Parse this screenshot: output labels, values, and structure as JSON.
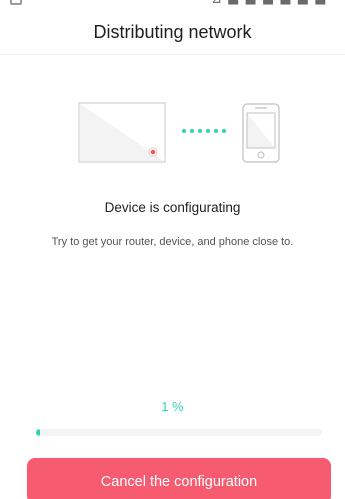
{
  "status_bar": {
    "right_text": "⊿ ■ ■ ■ ■ ■ ■"
  },
  "header": {
    "title": "Distributing network"
  },
  "illustration": {
    "icons": [
      "router-icon",
      "connection-dots-icon",
      "phone-icon"
    ],
    "colors": {
      "router_fill": "#f3f3f3",
      "router_stroke": "#c8c8c8",
      "router_led": "#f05a5a",
      "dots": "#2ed3b7",
      "phone_stroke": "#c0c0c0"
    }
  },
  "main": {
    "status_text": "Device is configurating",
    "hint_text": "Try to get your router, device, and phone close to."
  },
  "progress": {
    "value": 1,
    "label": "1 %",
    "color": "#2ed3b7"
  },
  "actions": {
    "cancel_label": "Cancel the configuration",
    "cancel_color": "#f65b6f"
  }
}
